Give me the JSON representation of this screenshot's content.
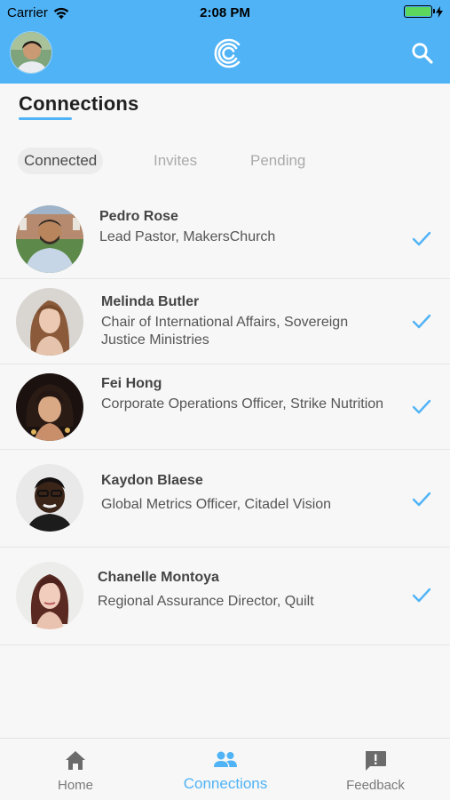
{
  "status_bar": {
    "carrier": "Carrier",
    "time": "2:08 PM"
  },
  "header": {
    "logo_icon": "crescent-c-logo",
    "search_icon": "search-icon"
  },
  "page": {
    "title": "Connections"
  },
  "tabs": [
    {
      "label": "Connected",
      "active": true
    },
    {
      "label": "Invites",
      "active": false
    },
    {
      "label": "Pending",
      "active": false
    }
  ],
  "connections": [
    {
      "name": "Pedro Rose",
      "role": "Lead Pastor, MakersChurch",
      "status_icon": "check-icon"
    },
    {
      "name": "Melinda Butler",
      "role": "Chair of International Affairs, Sovereign Justice Ministries",
      "status_icon": "check-icon"
    },
    {
      "name": "Fei Hong",
      "role": "Corporate Operations Officer, Strike Nutrition",
      "status_icon": "check-icon"
    },
    {
      "name": "Kaydon Blaese",
      "role": "Global Metrics Officer, Citadel Vision",
      "status_icon": "check-icon"
    },
    {
      "name": "Chanelle Montoya",
      "role": "Regional Assurance Director, Quilt",
      "status_icon": "check-icon"
    }
  ],
  "bottom_nav": {
    "home_label": "Home",
    "connections_label": "Connections",
    "feedback_label": "Feedback"
  },
  "colors": {
    "accent": "#4fb3f6",
    "background": "#f7f7f7",
    "battery": "#5cd65c"
  }
}
